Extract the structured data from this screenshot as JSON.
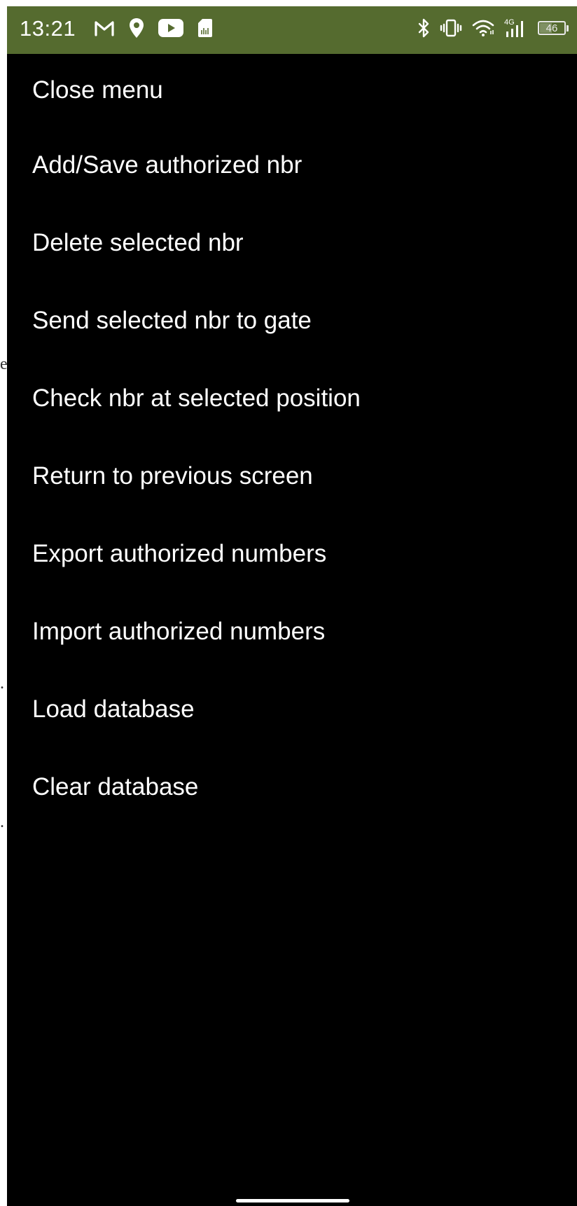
{
  "status_bar": {
    "time": "13:21",
    "left_icons": [
      "gmail-icon",
      "location-icon",
      "youtube-icon",
      "sim-card-icon"
    ],
    "right_icons": [
      "bluetooth-icon",
      "vibrate-icon",
      "wifi-icon",
      "signal-4g-icon"
    ],
    "network_label": "4G",
    "battery_level": "46",
    "background_color": "#556b2f"
  },
  "menu": {
    "items": [
      {
        "label": "Close menu"
      },
      {
        "label": "Add/Save authorized nbr"
      },
      {
        "label": "Delete selected nbr"
      },
      {
        "label": "Send selected nbr to gate"
      },
      {
        "label": "Check nbr at selected position"
      },
      {
        "label": "Return to previous screen"
      },
      {
        "label": "Export authorized numbers"
      },
      {
        "label": "Import authorized numbers"
      },
      {
        "label": "Load database"
      },
      {
        "label": "Clear database"
      }
    ]
  },
  "background_peek": {
    "fragments": [
      "e",
      ".",
      "."
    ]
  }
}
